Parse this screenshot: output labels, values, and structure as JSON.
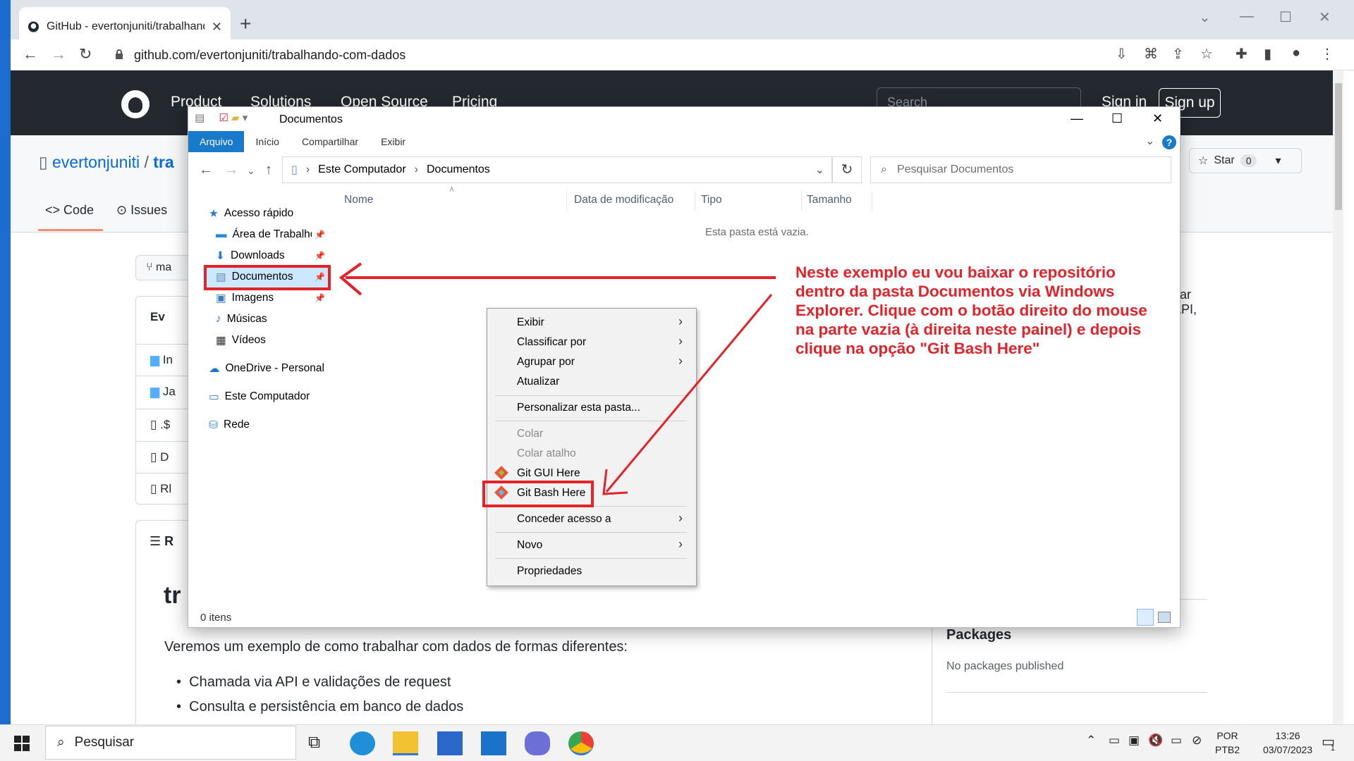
{
  "browser": {
    "tab_title": "GitHub - evertonjuniti/trabalhando-com-dados",
    "url": "github.com/evertonjuniti/trabalhando-com-dados"
  },
  "github": {
    "nav": [
      "Product",
      "Solutions",
      "Open Source",
      "Pricing"
    ],
    "search_placeholder": "Search",
    "search_key": "/",
    "signin": "Sign in",
    "signup": "Sign up",
    "repo_owner": "evertonjuniti",
    "repo_sep": "/",
    "repo_name_partial": "tra",
    "star_label": "Star",
    "star_count": "0",
    "tab_code": "Code",
    "tab_issues": "Issues",
    "branch_partial": "ma",
    "files_header_partial": "Ev",
    "file_rows": [
      "In",
      "Ja",
      ".$",
      "D",
      "Rl"
    ],
    "readme_label_partial": "R",
    "readme_title_partial": "tr",
    "readme_paragraph": "Veremos um exemplo de como trabalhar com dados de formas diferentes:",
    "readme_bullets": [
      "Chamada via API e validações de request",
      "Consulta e persistência em banco de dados"
    ],
    "side_right_partial_1": "har",
    "side_right_partial_2": "API,",
    "packages_title": "Packages",
    "packages_text": "No packages published"
  },
  "explorer": {
    "title": "Documentos",
    "ribbon_tabs": [
      "Arquivo",
      "Início",
      "Compartilhar",
      "Exibir"
    ],
    "help": "?",
    "breadcrumb": [
      "Este Computador",
      "Documentos"
    ],
    "search_placeholder": "Pesquisar Documentos",
    "nav": {
      "quick_access": "Acesso rápido",
      "desktop": "Área de Trabalho",
      "downloads": "Downloads",
      "documents": "Documentos",
      "images": "Imagens",
      "music": "Músicas",
      "videos": "Vídeos",
      "onedrive": "OneDrive - Personal",
      "this_pc": "Este Computador",
      "network": "Rede"
    },
    "columns": [
      "Nome",
      "Data de modificação",
      "Tipo",
      "Tamanho"
    ],
    "empty_message": "Esta pasta está vazia.",
    "status": "0 itens"
  },
  "context_menu": {
    "view": "Exibir",
    "sort_by": "Classificar por",
    "group_by": "Agrupar por",
    "refresh": "Atualizar",
    "customize": "Personalizar esta pasta...",
    "paste": "Colar",
    "paste_shortcut": "Colar atalho",
    "git_gui": "Git GUI Here",
    "git_bash": "Git Bash Here",
    "give_access": "Conceder acesso a",
    "new": "Novo",
    "properties": "Propriedades"
  },
  "annotation": {
    "text": "Neste exemplo eu vou baixar o repositório dentro da pasta Documentos via Windows Explorer. Clique com o botão direito do mouse na parte vazia (à direita neste painel) e depois clique na opção \"Git Bash Here\""
  },
  "taskbar": {
    "search": "Pesquisar",
    "lang_1": "POR",
    "lang_2": "PTB2",
    "time": "13:26",
    "date": "03/07/2023",
    "notifications": "1"
  },
  "colors": {
    "annotation_red": "#e2232a",
    "explorer_accent": "#1979ca",
    "github_header": "#24292f",
    "github_link": "#0969da"
  }
}
